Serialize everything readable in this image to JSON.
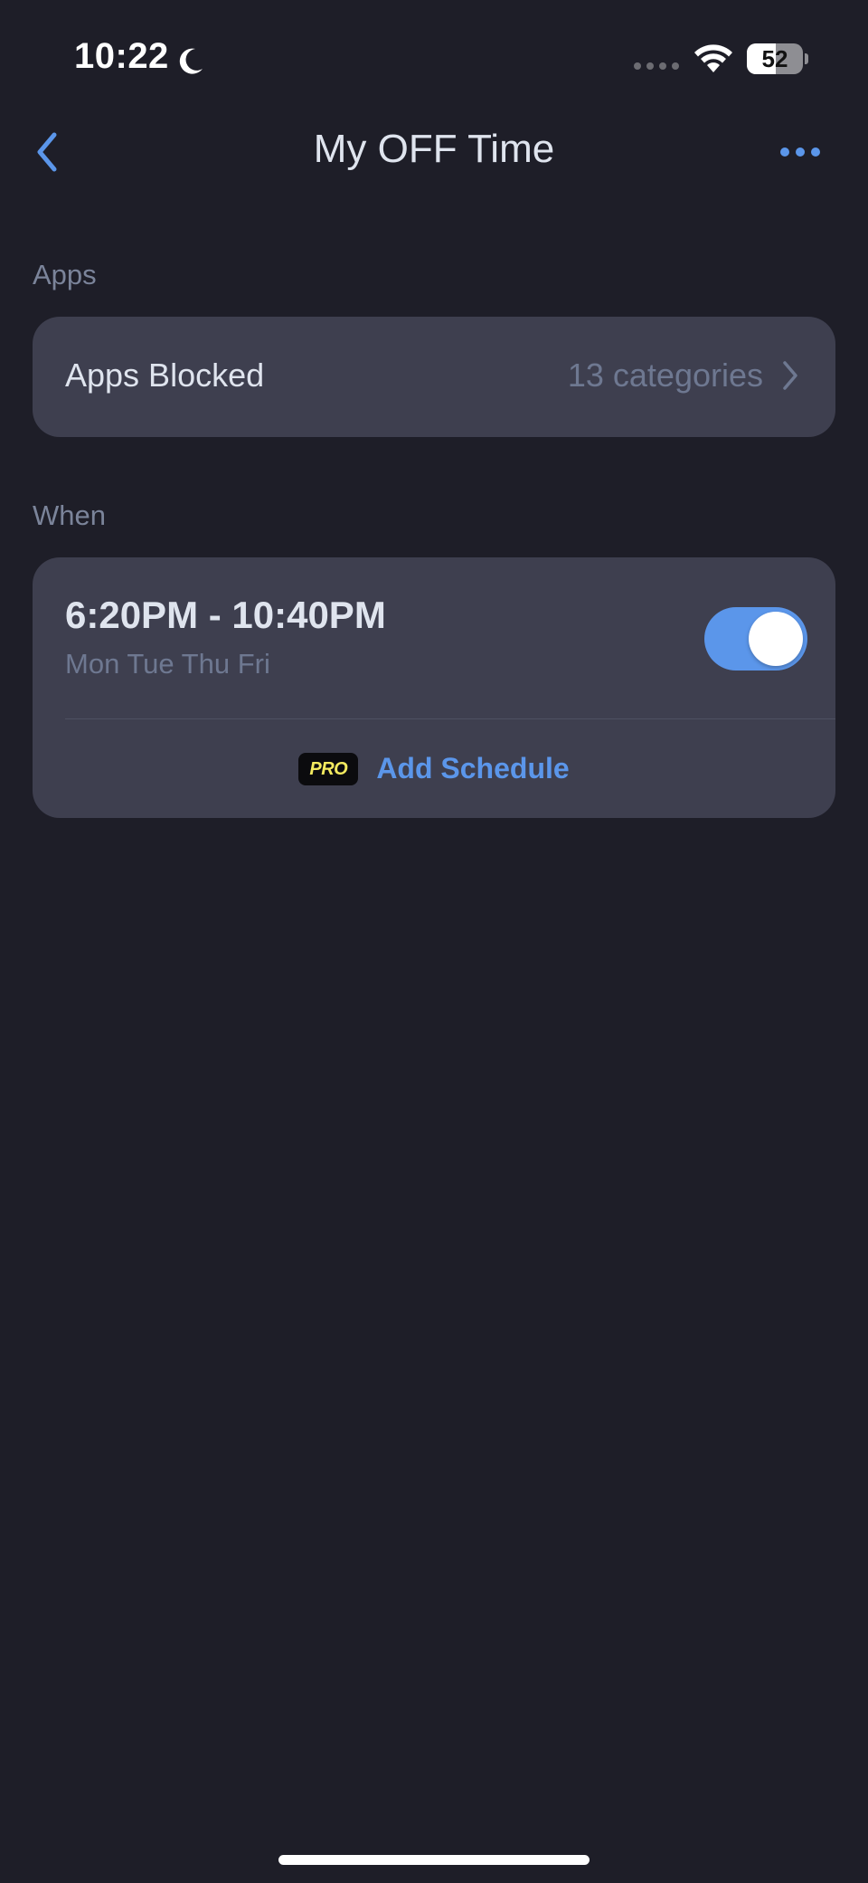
{
  "status_bar": {
    "time": "10:22",
    "battery_level": "52",
    "battery_fraction": 0.52,
    "icons": [
      "moon-icon",
      "cellular-signal-icon",
      "wifi-icon",
      "battery-icon"
    ]
  },
  "nav": {
    "title": "My OFF Time",
    "back_icon": "chevron-left-icon",
    "more_icon": "ellipsis-icon"
  },
  "apps_section": {
    "header": "Apps",
    "row_label": "Apps Blocked",
    "row_value": "13 categories"
  },
  "when_section": {
    "header": "When",
    "schedule": {
      "time_range": "6:20PM - 10:40PM",
      "days": "Mon Tue Thu Fri",
      "enabled": true
    },
    "add_schedule": {
      "badge": "PRO",
      "label": "Add Schedule"
    }
  },
  "colors": {
    "background": "#1e1e28",
    "card": "#3e3f4f",
    "accent": "#5b96ea",
    "pro_badge_text": "#f3ea5f"
  }
}
